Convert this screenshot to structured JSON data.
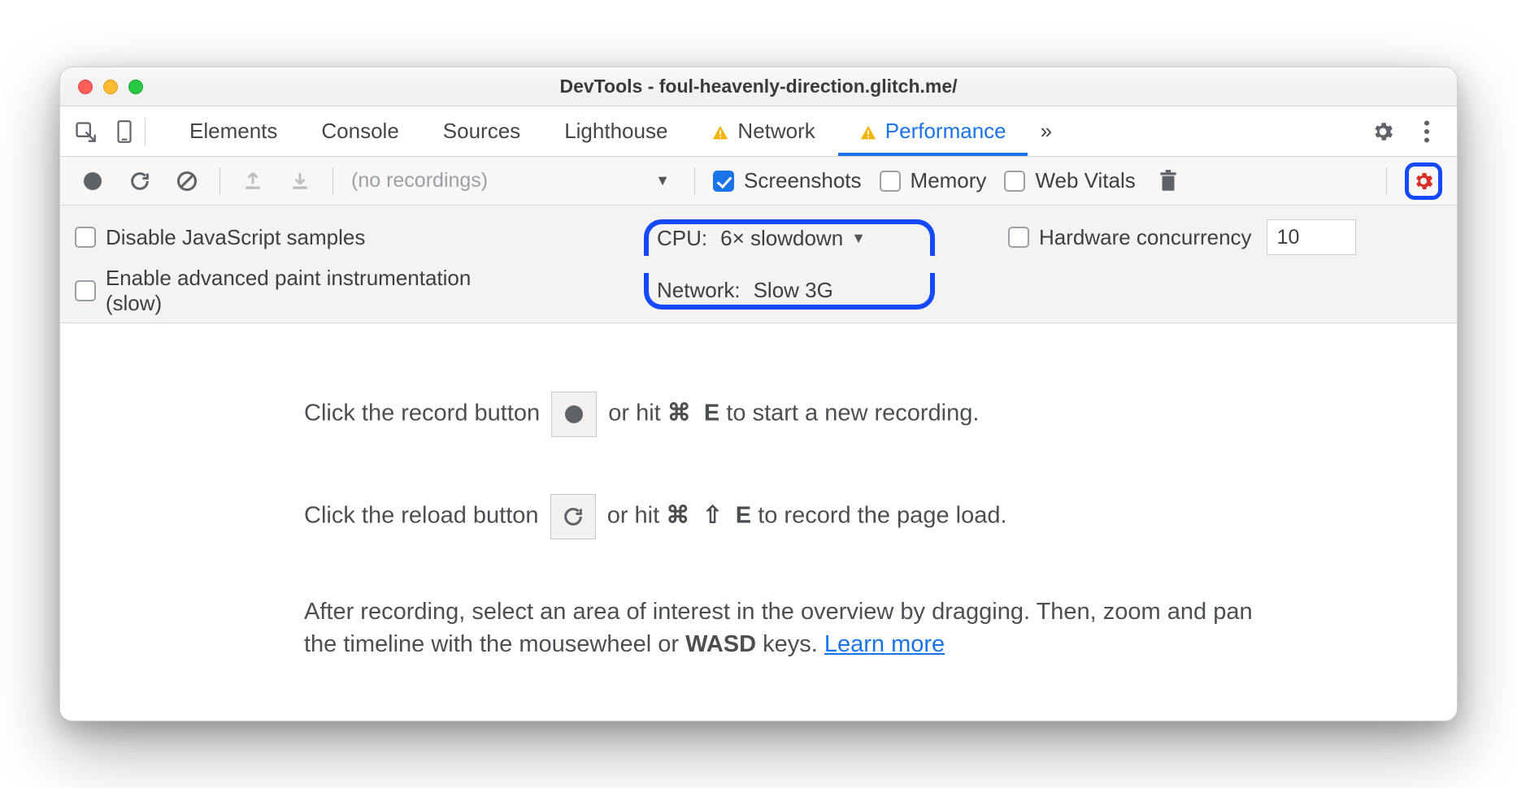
{
  "window": {
    "title": "DevTools - foul-heavenly-direction.glitch.me/"
  },
  "tabs": {
    "items": [
      "Elements",
      "Console",
      "Sources",
      "Lighthouse",
      "Network",
      "Performance"
    ],
    "active": "Performance",
    "more_glyph": "»"
  },
  "toolbar": {
    "recordings_placeholder": "(no recordings)",
    "screenshots_label": "Screenshots",
    "memory_label": "Memory",
    "webvitals_label": "Web Vitals"
  },
  "settings": {
    "disable_js_label": "Disable JavaScript samples",
    "paint_label": "Enable advanced paint instrumentation (slow)",
    "cpu_label": "CPU:",
    "cpu_value": "6× slowdown",
    "network_label": "Network:",
    "network_value": "Slow 3G",
    "hw_label": "Hardware concurrency",
    "hw_value": "10"
  },
  "body": {
    "rec1_a": "Click the record button ",
    "rec1_b": " or hit ",
    "rec1_key1": "⌘",
    "rec1_key2": "E",
    "rec1_c": " to start a new recording.",
    "rel1_a": "Click the reload button ",
    "rel1_b": " or hit ",
    "rel1_key1": "⌘",
    "rel1_key2": "⇧",
    "rel1_key3": "E",
    "rel1_c": " to record the page load.",
    "after_a": "After recording, select an area of interest in the overview by dragging. Then, zoom and pan the timeline with the mousewheel or ",
    "after_wasd": "WASD",
    "after_b": " keys. ",
    "learn": "Learn more"
  }
}
